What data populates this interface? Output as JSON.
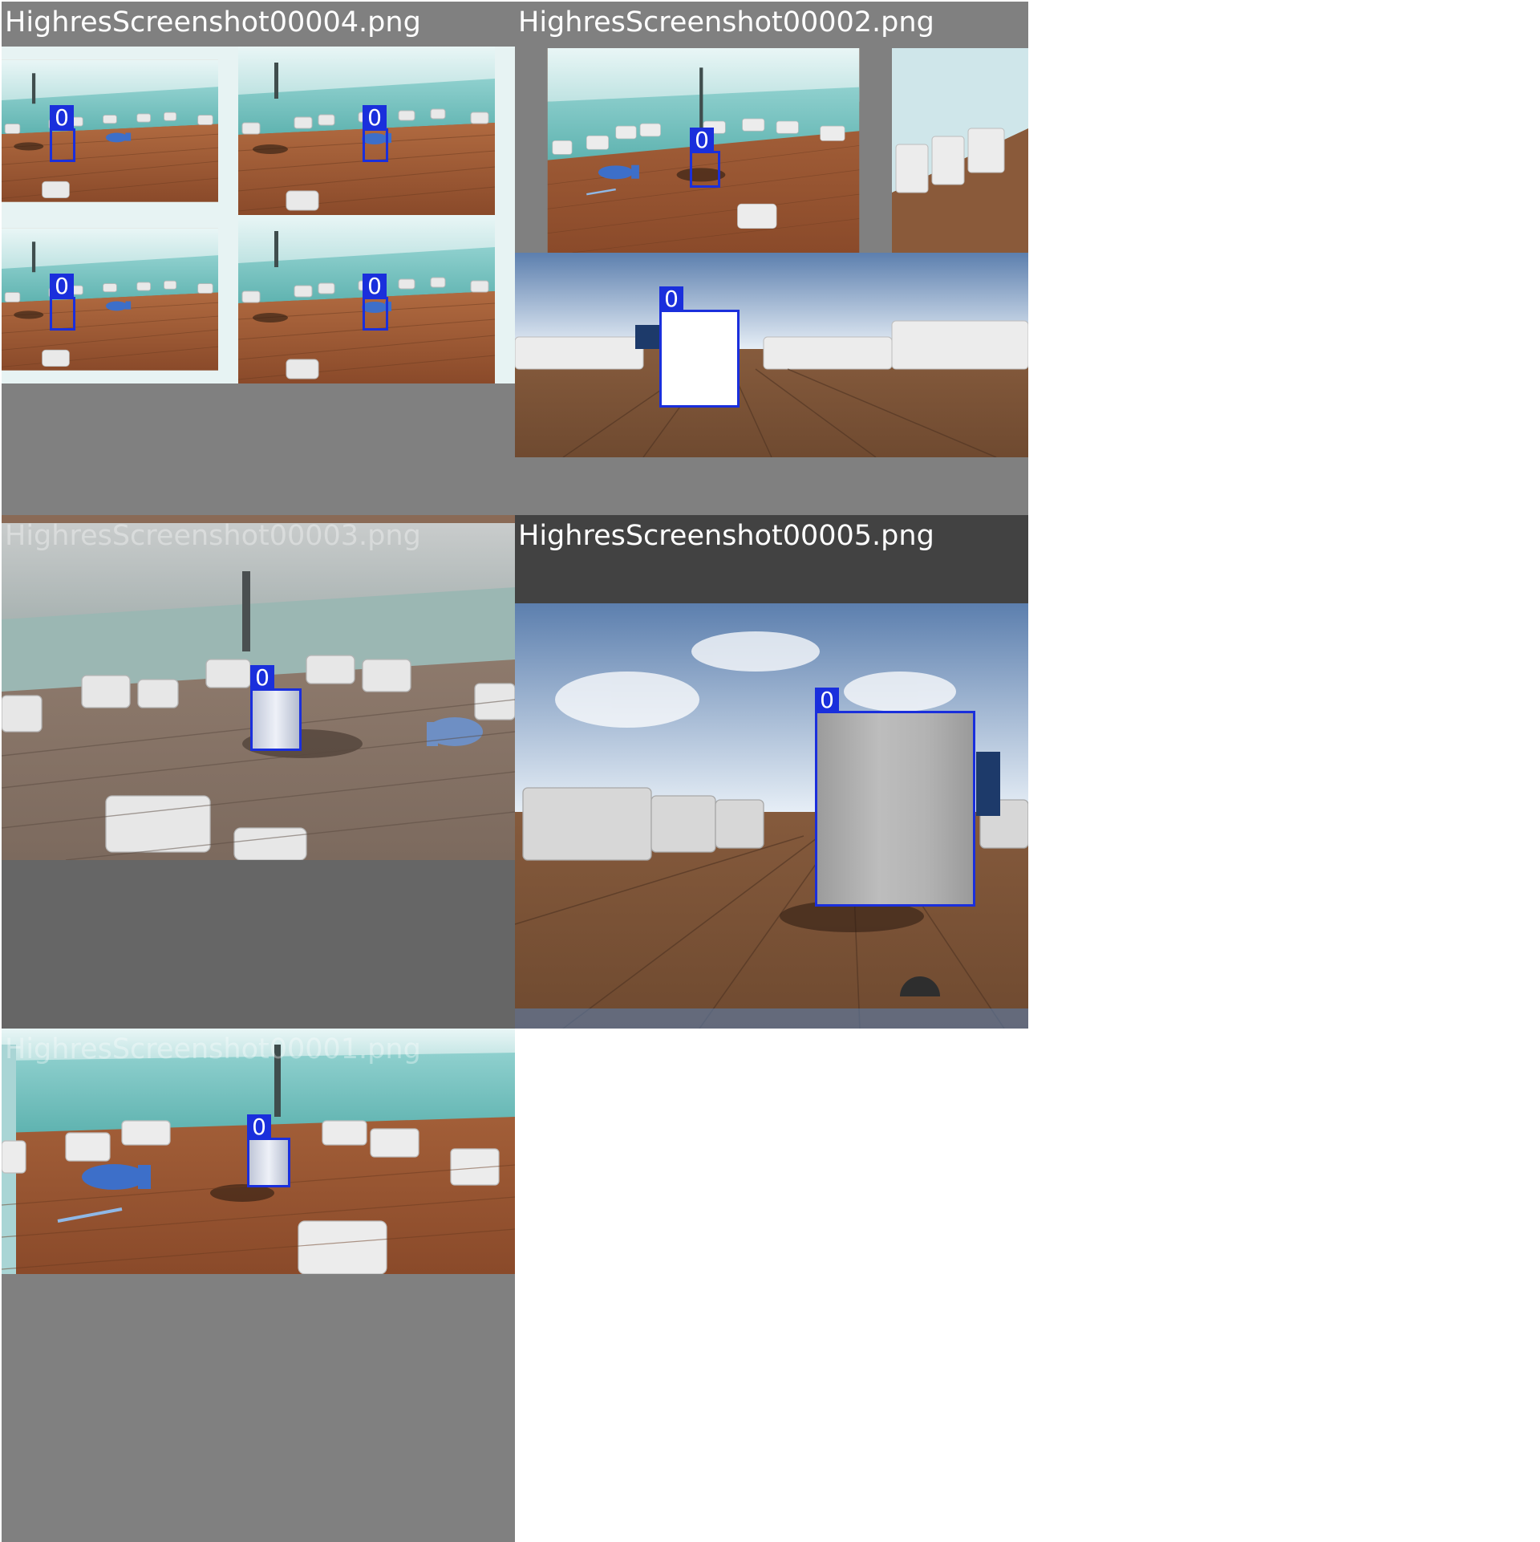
{
  "tiles": [
    {
      "title": "HighresScreenshot00004.png",
      "box_label": "0"
    },
    {
      "title": "HighresScreenshot00002.png",
      "box_label": "0"
    },
    {
      "title": "HighresScreenshot00003.png",
      "box_label": "0"
    },
    {
      "title": "HighresScreenshot00005.png",
      "box_label": "0"
    },
    {
      "title": "HighresScreenshot00001.png",
      "box_label": "0"
    }
  ],
  "colors": {
    "bbox": "#1a2fdc",
    "grey_bg": "#808080",
    "dark_grey_bg": "#666666",
    "deck": "#a8623a",
    "sea": "#7fc6c6"
  }
}
